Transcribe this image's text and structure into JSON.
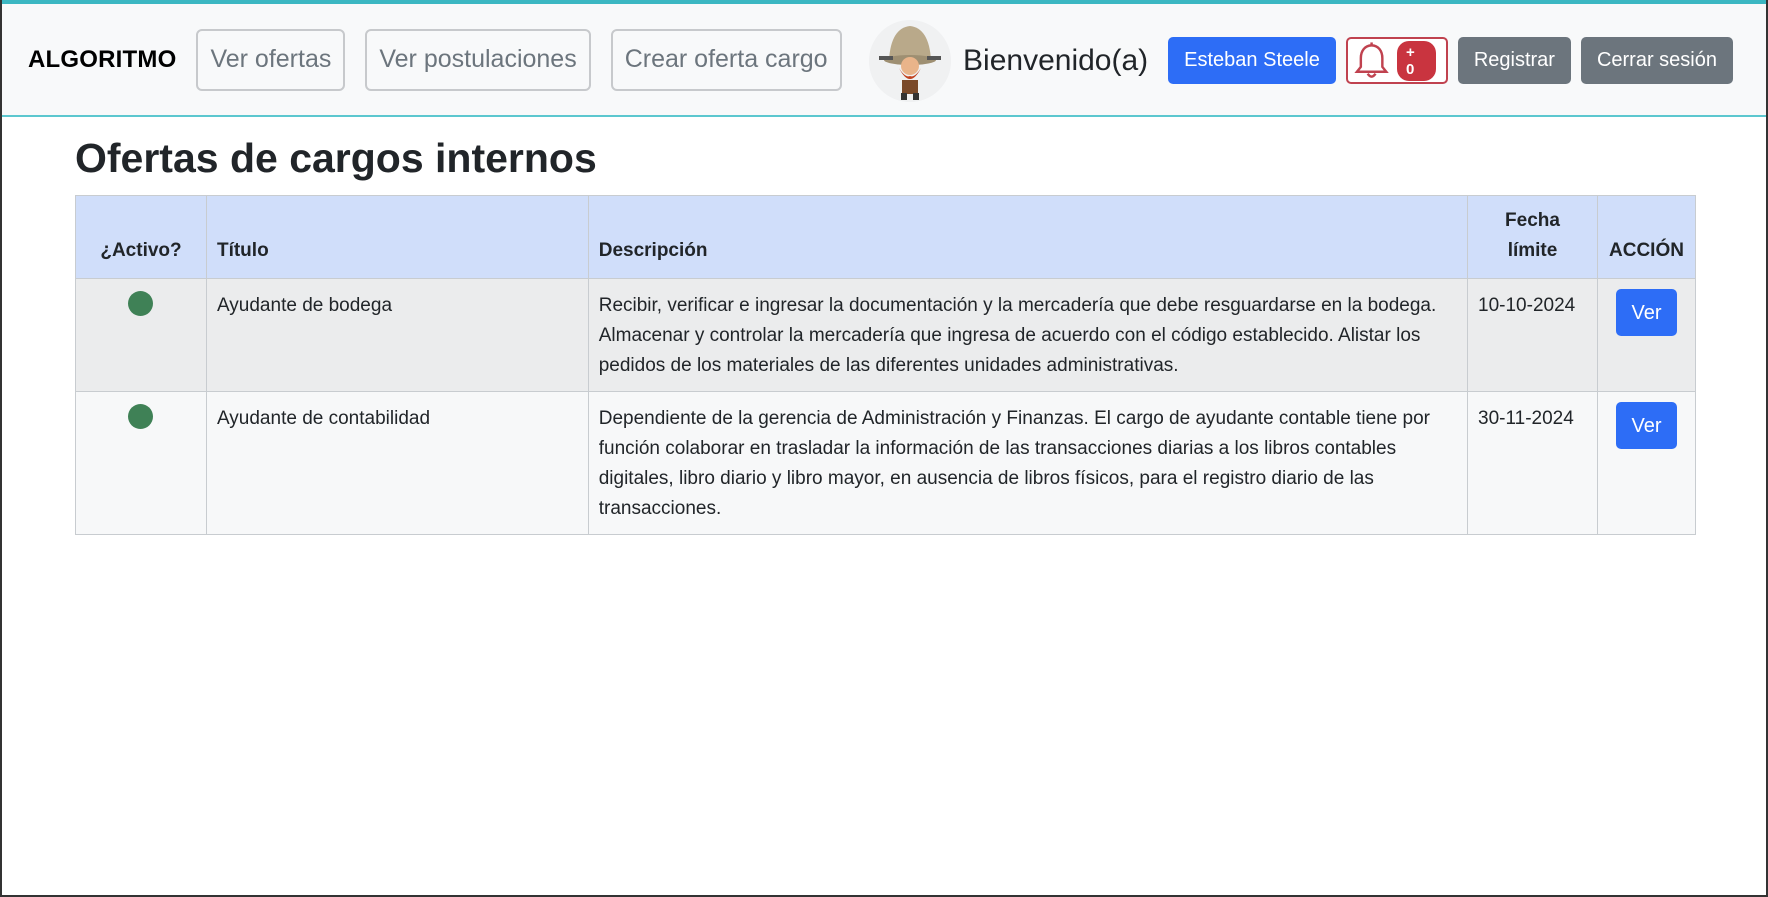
{
  "navbar": {
    "brand": "ALGORITMO",
    "links": [
      "Ver ofertas",
      "Ver postulaciones",
      "Crear oferta cargo"
    ],
    "welcome": "Bienvenido(a)",
    "user_button": "Esteban Steele",
    "notification_badge": "+ 0",
    "register_button": "Registrar",
    "logout_button": "Cerrar sesión"
  },
  "page": {
    "title": "Ofertas de cargos internos"
  },
  "table": {
    "headers": {
      "active": "¿Activo?",
      "title": "Título",
      "description": "Descripción",
      "deadline": "Fecha límite",
      "action": "ACCIÓN"
    },
    "rows": [
      {
        "active": true,
        "title": "Ayudante de bodega",
        "description": "Recibir, verificar e ingresar la documentación y la mercadería que debe resguardarse en la bodega. Almacenar y controlar la mercadería que ingresa de acuerdo con el código establecido. Alistar los pedidos de los materiales de las diferentes unidades administrativas.",
        "deadline": "10-10-2024",
        "action_label": "Ver"
      },
      {
        "active": true,
        "title": "Ayudante de contabilidad",
        "description": "Dependiente de la gerencia de Administración y Finanzas. El cargo de ayudante contable tiene por función colaborar en trasladar la información de las transacciones diarias a los libros contables digitales, libro diario y libro mayor, en ausencia de libros físicos, para el registro diario de las transacciones.",
        "deadline": "30-11-2024",
        "action_label": "Ver"
      }
    ]
  },
  "colors": {
    "primary": "#2d6df6",
    "secondary": "#6c757d",
    "active_dot": "#3f8156",
    "header_bg": "#d0defa",
    "bell": "#c0424f"
  },
  "icons": {
    "avatar": "avatar-image",
    "bell": "bell-icon",
    "status": "status-dot-icon"
  }
}
